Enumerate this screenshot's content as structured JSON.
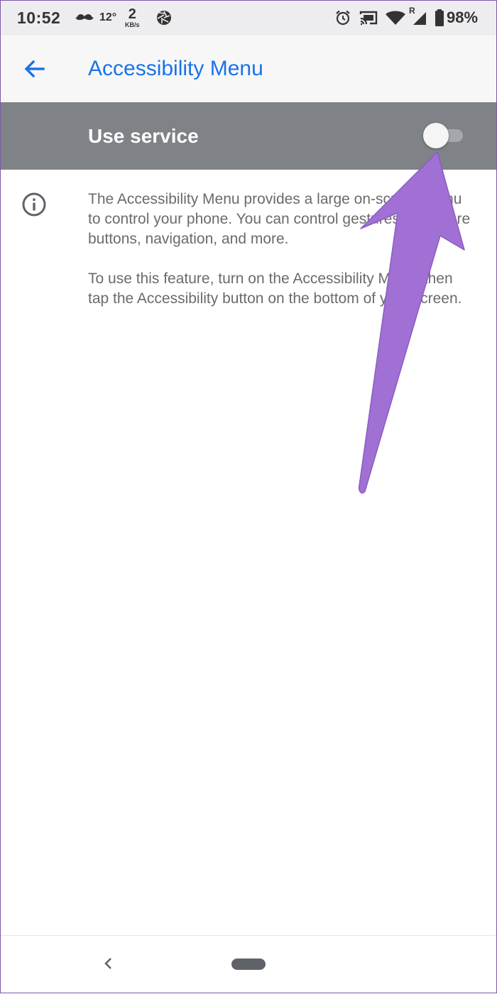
{
  "status_bar": {
    "time": "10:52",
    "temperature": "12°",
    "speed_value": "2",
    "speed_unit": "KB/s",
    "roaming_indicator": "R",
    "battery_percent": "98%",
    "icons": [
      "mustache-icon",
      "aperture-icon",
      "alarm-icon",
      "cast-icon",
      "wifi-icon",
      "cell-signal-icon",
      "battery-icon"
    ]
  },
  "app_bar": {
    "title": "Accessibility Menu",
    "back_icon": "back-arrow-icon",
    "accent_color": "#1a73e8"
  },
  "service": {
    "label": "Use service",
    "toggle_state": "off",
    "row_color": "#7f8286"
  },
  "description": {
    "icon": "info-icon",
    "paragraph_1": "The Accessibility Menu provides a large on-screen menu to control your phone. You can control gestures, hardware buttons, navigation, and more.",
    "paragraph_2": "To use this feature, turn on the Accessibility Menu, then tap the Accessibility button on the bottom of your screen."
  },
  "annotation": {
    "icon": "pointer-arrow-icon",
    "color": "#a070d4"
  },
  "nav_bar": {
    "back_icon": "nav-back-icon",
    "home_icon": "home-pill-icon"
  }
}
